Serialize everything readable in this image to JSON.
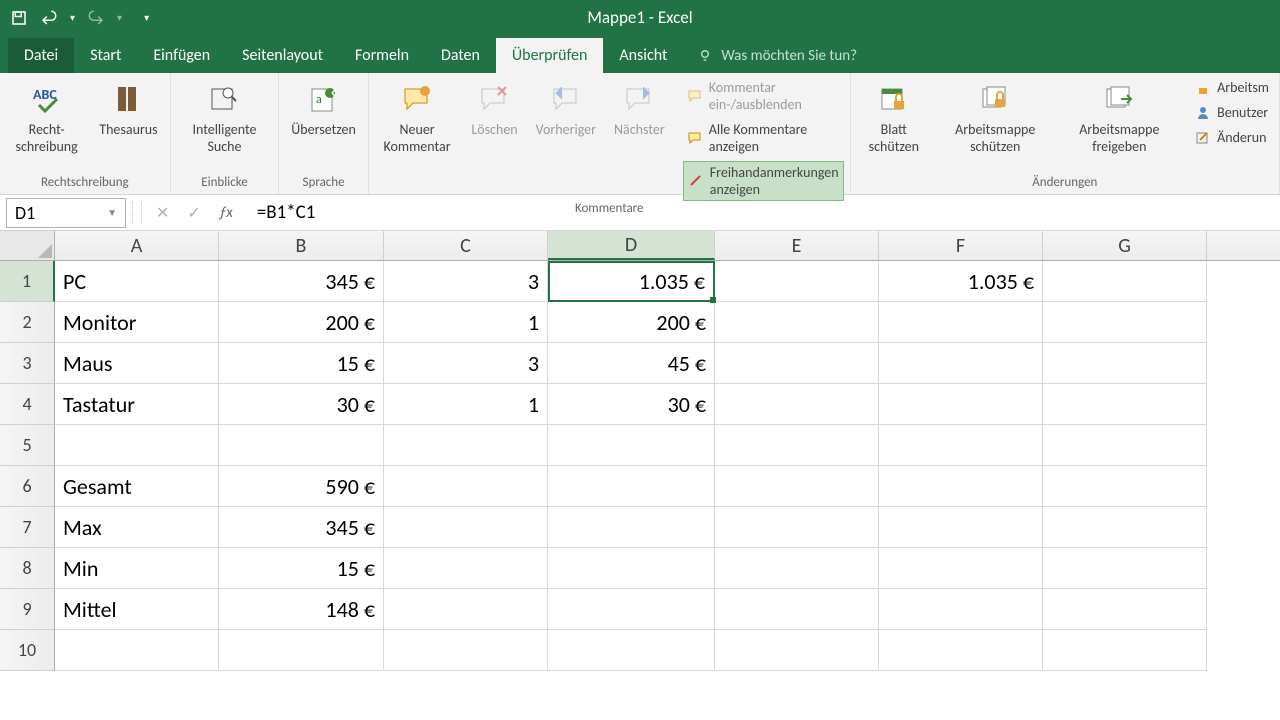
{
  "title": "Mappe1 - Excel",
  "tabs": {
    "file": "Datei",
    "home": "Start",
    "insert": "Einfügen",
    "layout": "Seitenlayout",
    "formulas": "Formeln",
    "data": "Daten",
    "review": "Überprüfen",
    "view": "Ansicht",
    "tellme": "Was möchten Sie tun?"
  },
  "ribbon": {
    "spelling": "Recht-schreibung",
    "thesaurus": "Thesaurus",
    "proofing_group": "Rechtschreibung",
    "smart_lookup": "Intelligente Suche",
    "insights_group": "Einblicke",
    "translate": "Übersetzen",
    "language_group": "Sprache",
    "new_comment": "Neuer Kommentar",
    "delete": "Löschen",
    "previous": "Vorheriger",
    "next": "Nächster",
    "show_hide": "Kommentar ein-/ausblenden",
    "show_all": "Alle Kommentare anzeigen",
    "show_ink": "Freihandanmerkungen anzeigen",
    "comments_group": "Kommentare",
    "protect_sheet": "Blatt schützen",
    "protect_wb": "Arbeitsmappe schützen",
    "share_wb": "Arbeitsmappe freigeben",
    "share_protect": "Arbeitsm",
    "allow_users": "Benutzer",
    "track_changes": "Änderun",
    "changes_group": "Änderungen"
  },
  "namebox": "D1",
  "formula": "=B1*C1",
  "columns": [
    "A",
    "B",
    "C",
    "D",
    "E",
    "F",
    "G"
  ],
  "rows": [
    "1",
    "2",
    "3",
    "4",
    "5",
    "6",
    "7",
    "8",
    "9",
    "10"
  ],
  "cells": {
    "A1": "PC",
    "B1": "345 €",
    "C1": "3",
    "D1": "1.035 €",
    "F1": "1.035 €",
    "A2": "Monitor",
    "B2": "200 €",
    "C2": "1",
    "D2": "200 €",
    "A3": "Maus",
    "B3": "15 €",
    "C3": "3",
    "D3": "45 €",
    "A4": "Tastatur",
    "B4": "30 €",
    "C4": "1",
    "D4": "30 €",
    "A6": "Gesamt",
    "B6": "590 €",
    "A7": "Max",
    "B7": "345 €",
    "A8": "Min",
    "B8": "15 €",
    "A9": "Mittel",
    "B9": "148 €"
  }
}
